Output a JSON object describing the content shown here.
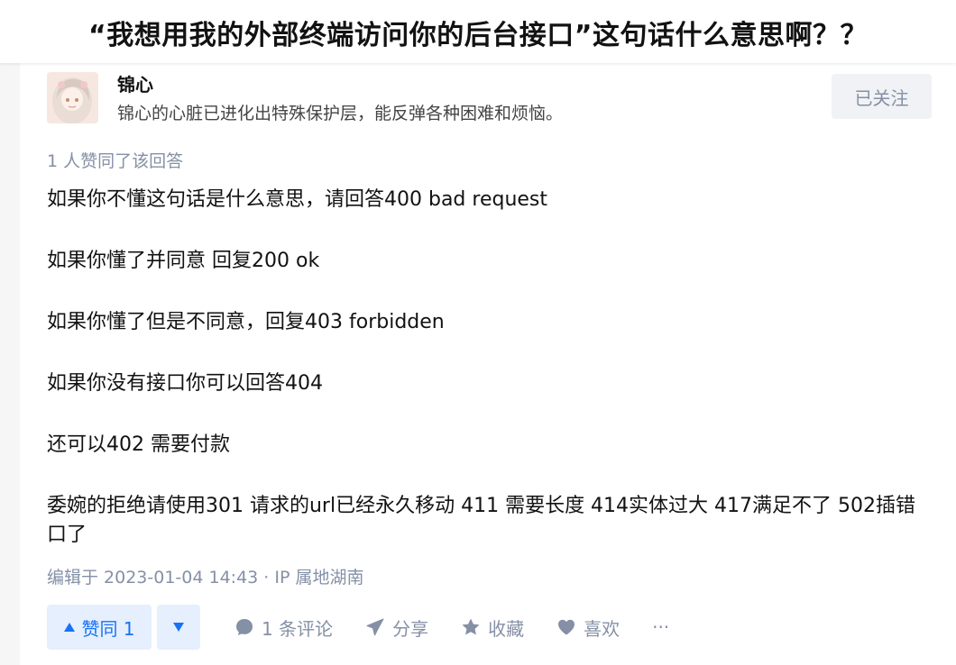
{
  "question": {
    "title": "“我想用我的外部终端访问你的后台接口”这句话什么意思啊？？"
  },
  "author": {
    "name": "锦心",
    "bio": "锦心的心脏已进化出特殊保护层，能反弹各种困难和烦恼。",
    "follow_label": "已关注"
  },
  "answer": {
    "vote_summary": "1 人赞同了该回答",
    "paragraphs": [
      "如果你不懂这句话是什么意思，请回答400 bad request",
      "如果你懂了并同意 回复200 ok",
      "如果你懂了但是不同意，回复403 forbidden",
      "如果你没有接口你可以回答404",
      "还可以402 需要付款",
      "委婉的拒绝请使用301 请求的url已经永久移动 411 需要长度 414实体过大 417满足不了 502插错口了"
    ],
    "edit_meta": "编辑于 2023-01-04 14:43 · IP 属地湖南"
  },
  "actions": {
    "upvote_label": "赞同 1",
    "comment_label": "1 条评论",
    "share_label": "分享",
    "collect_label": "收藏",
    "like_label": "喜欢",
    "more_label": "···"
  },
  "colors": {
    "accent": "#1772f6",
    "accent_bg": "#e5effd",
    "meta_gray": "#8590a6"
  },
  "icons": {
    "upvote": "triangle-up-icon",
    "downvote": "triangle-down-icon",
    "comment": "comment-bubble-icon",
    "share": "paper-plane-icon",
    "collect": "star-icon",
    "like": "heart-icon",
    "more": "more-dots-icon"
  }
}
